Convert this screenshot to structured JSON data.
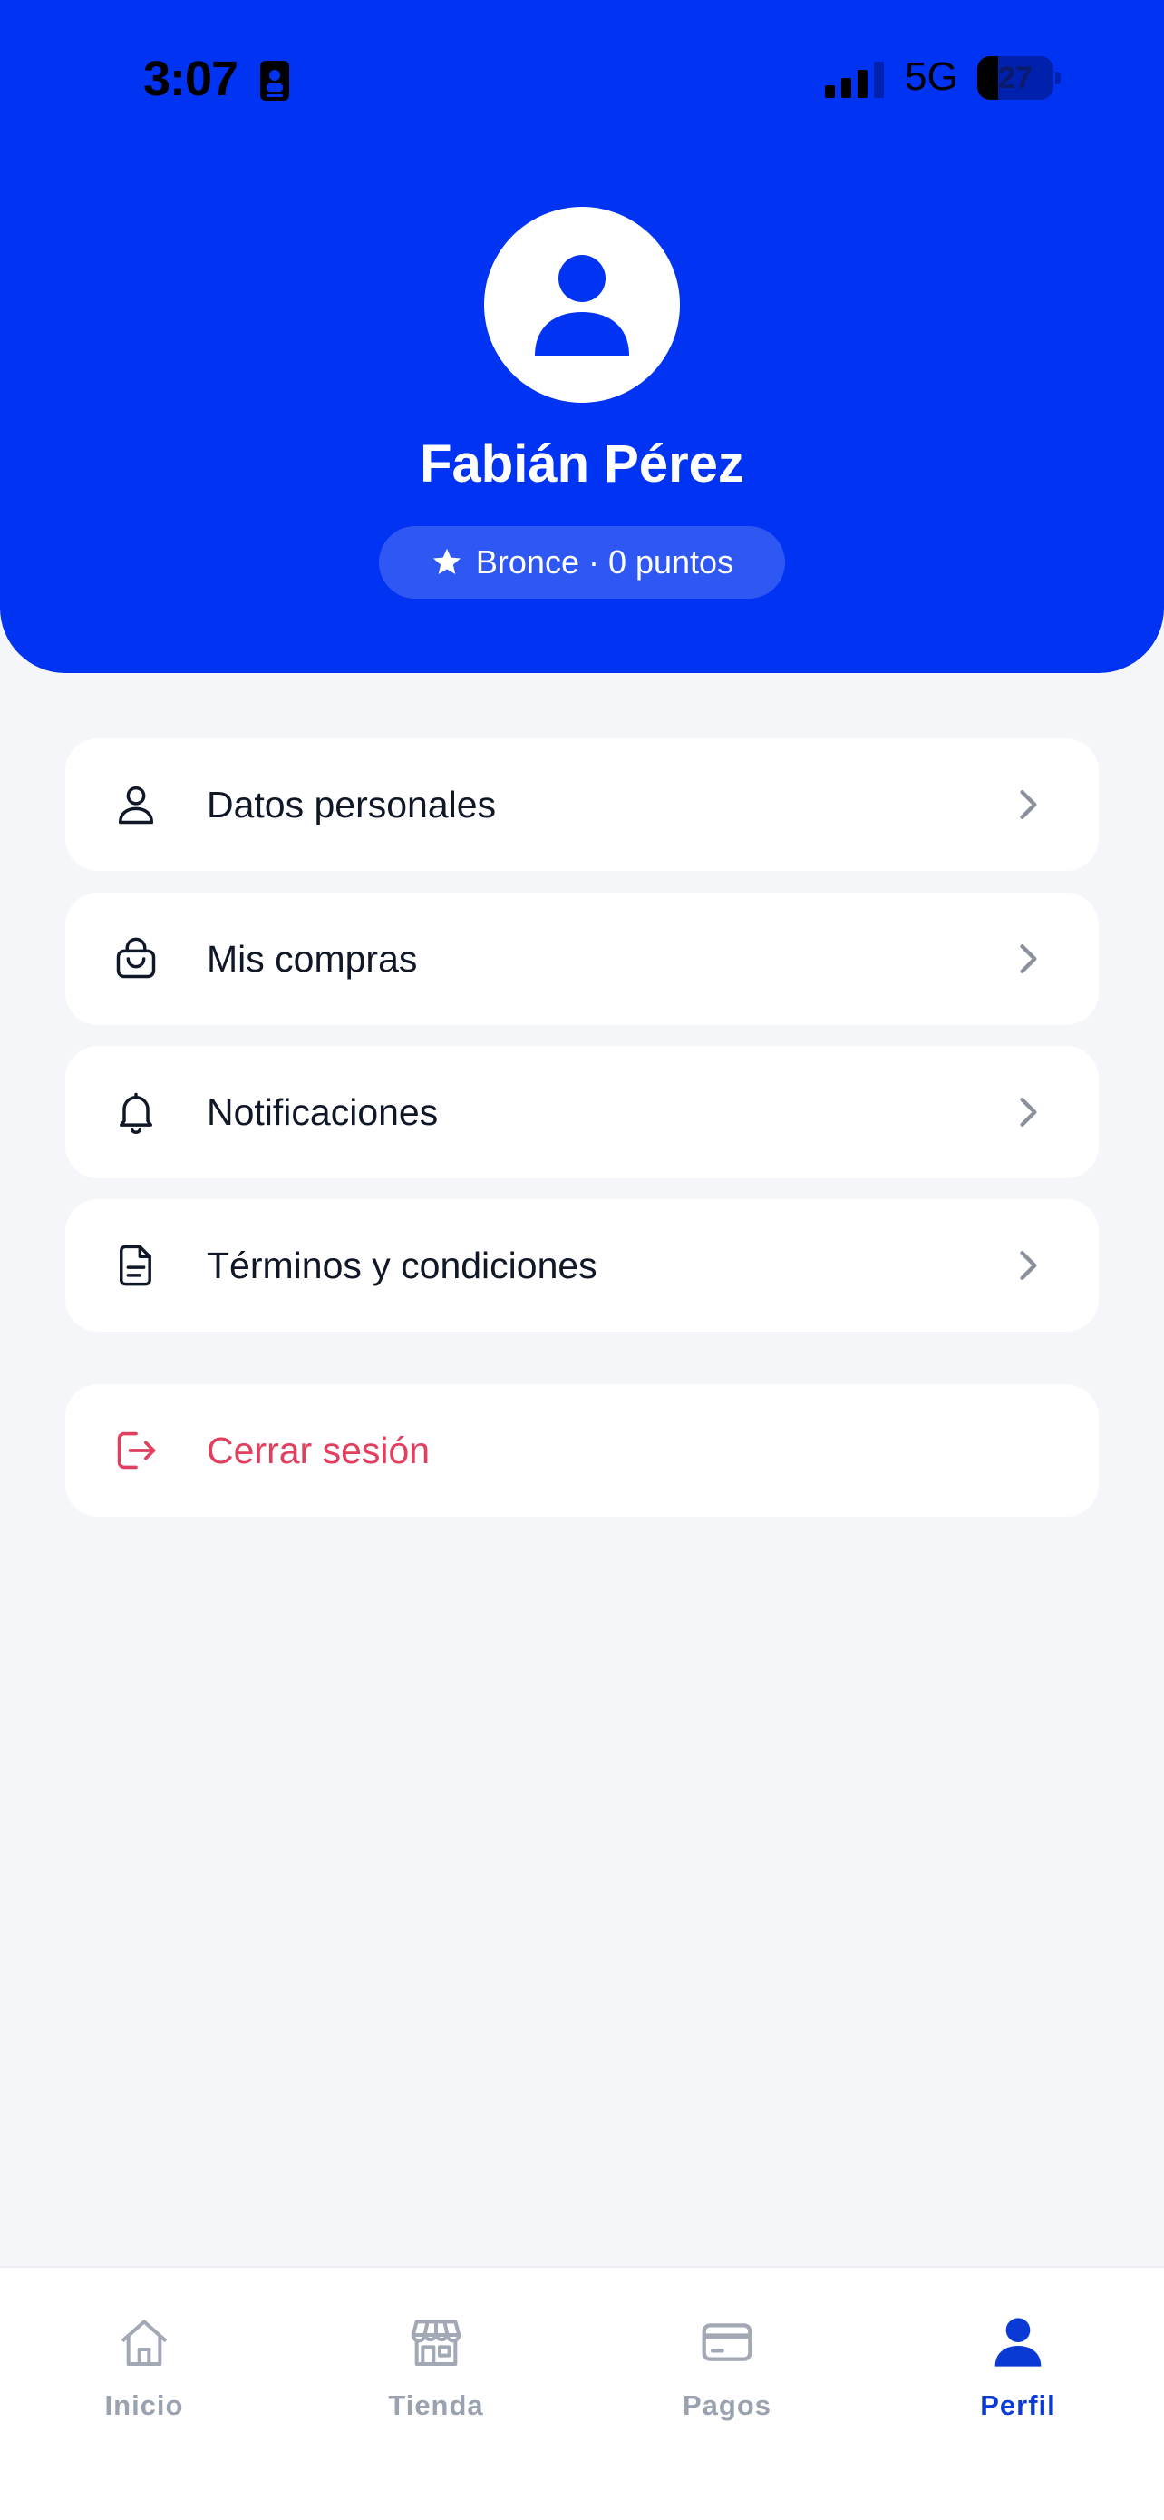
{
  "status_bar": {
    "time": "3:07",
    "network": "5G",
    "battery": "27",
    "battery_level": 0.27
  },
  "profile": {
    "name": "Fabián Pérez",
    "tier": "Bronce · 0 puntos"
  },
  "menu": {
    "items": [
      {
        "label": "Datos personales",
        "icon": "user-icon"
      },
      {
        "label": "Mis compras",
        "icon": "shopping-bag-icon"
      },
      {
        "label": "Notificaciones",
        "icon": "bell-icon"
      },
      {
        "label": "Términos y condiciones",
        "icon": "document-icon"
      }
    ],
    "logout": {
      "label": "Cerrar sesión",
      "icon": "logout-icon"
    }
  },
  "bottom_nav": {
    "items": [
      {
        "label": "Inicio",
        "icon": "home-icon",
        "active": false
      },
      {
        "label": "Tienda",
        "icon": "store-icon",
        "active": false
      },
      {
        "label": "Pagos",
        "icon": "card-icon",
        "active": false
      },
      {
        "label": "Perfil",
        "icon": "profile-icon",
        "active": true
      }
    ]
  },
  "colors": {
    "brand": "#0033f2",
    "background": "#f5f6fa",
    "danger": "#e0405e",
    "nav_active": "#0a3ad6",
    "nav_inactive": "#9ba2af"
  }
}
